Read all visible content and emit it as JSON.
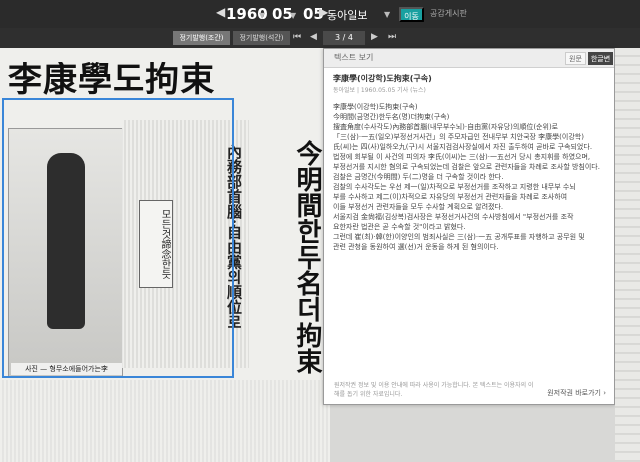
{
  "topbar": {
    "prev_arrow": "◀",
    "year": "1960",
    "month": "05",
    "day": "05",
    "next_arrow": "▶",
    "paper": "동아일보",
    "move_label": "이동",
    "pub_date": "공감게시판"
  },
  "subbar": {
    "tab1": "정기발행(조간)",
    "tab2": "정기발행(석간)",
    "first": "⏮",
    "prev": "◀",
    "page": "3 / 4",
    "next": "▶",
    "last": "⏭"
  },
  "newspaper": {
    "headline": "李康學도拘束",
    "vertical_headline": "今明間한두名더拘束",
    "vertical_sub": "內務部首腦·自由黨의順位로",
    "quote": "모든것諦念한듯",
    "caption": "사진 — 형무소에들어가는李"
  },
  "panel": {
    "title": "텍스트 보기",
    "tab_original": "원문",
    "tab_korean": "한글변환",
    "article_title": "李康學(이강학)도拘束(구속)",
    "meta": "동아일보 | 1960.05.05 기사 (뉴스)",
    "lines": [
      "李康學(이강학)도拘束(구속)",
      "今明間(금명간)한두名(명)더拘束(구속)",
      "搜査角度(수사각도)內務部首腦(내무부수뇌)·自由黨(자유당)의順位(순위)로",
      "",
      "「三(삼)·一五(일오)부정선거사건」의 주모자급인 전내무부 치안국장 李康學(이강학)",
      "氏(씨)는 四(사)일하오九(구)시 서울지검검사장실에서 자진 출두하여 곧바로 구속되었다.",
      "법정에 회부될 이 사건의 피의자 李氏(이씨)는 三(삼)·一五선거 당시 총지휘를 하였으며,",
      "부정선거를 지시한 혐의로 구속되었는데 검찰은 앞으로 관련자들을 차례로 조사할 방침이다.",
      "",
      "검찰은 금명간(今明間) 두(二)명을 더 구속할 것이라 한다.",
      "",
      "검찰의 수사각도는 우선 제一(일)차적으로 부정선거를 조작하고 지령한 내무부 수뇌",
      "부를 수사하고 제二(이)차적으로 자유당의 부정선거 관련자들을 차례로 조사하여",
      "이들 부정선거 관련자들을 모두 수사할 계획으로 알려졌다.",
      "",
      "서울지검 金尙福(김상복)검사장은 부정선거사건의 수사방침에서 \"부정선거를 조작",
      "요한자란 법관은 곧 수속할 것\"이라고 밝혔다.",
      "",
      "그런데 崔(최)·韓(한)이양인의 범죄사실은 三(삼)·一五 공개투표를 자행하고 공무원 및",
      "관련 관청을 동원하여 選(선)거 운동을 하게 된 혐의이다."
    ],
    "footer": "원저작권 정보 및 이용 안내에 따라 사용이 가능합니다. 본 텍스트는 이용자의 이해를 돕기 위한 자료입니다.",
    "footer_btn": "원저작권 바로가기 ›"
  }
}
